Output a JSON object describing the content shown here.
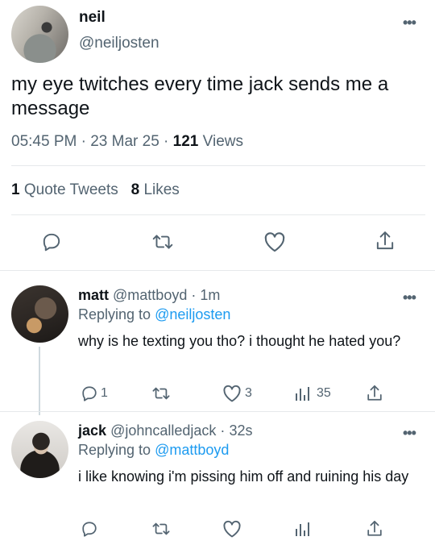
{
  "main_tweet": {
    "author_name": "neil",
    "author_handle": "@neiljosten",
    "text": "my eye twitches every time jack sends me a message",
    "time": "05:45 PM",
    "date": "23 Mar 25",
    "views_count": "121",
    "views_label": "Views",
    "quote_count": "1",
    "quote_label": "Quote Tweets",
    "likes_count": "8",
    "likes_label": "Likes"
  },
  "replies": [
    {
      "author_name": "matt",
      "author_handle": "@mattboyd",
      "time": "1m",
      "replying_label": "Replying to",
      "replying_to": "@neiljosten",
      "text": "why is he texting you tho? i thought he hated you?",
      "reply_count": "1",
      "like_count": "3",
      "view_count": "35"
    },
    {
      "author_name": "jack",
      "author_handle": "@johncalledjack",
      "time": "32s",
      "replying_label": "Replying to",
      "replying_to": "@mattboyd",
      "text": "i like knowing i'm pissing him off and ruining his day"
    }
  ],
  "separator": "·",
  "more_glyph": "•••",
  "icons": [
    "reply-icon",
    "retweet-icon",
    "like-icon",
    "share-icon",
    "views-icon",
    "more-icon"
  ],
  "colors": {
    "text": "#0f1419",
    "secondary": "#536471",
    "link": "#1d9bf0",
    "divider": "#e6e9eb"
  }
}
